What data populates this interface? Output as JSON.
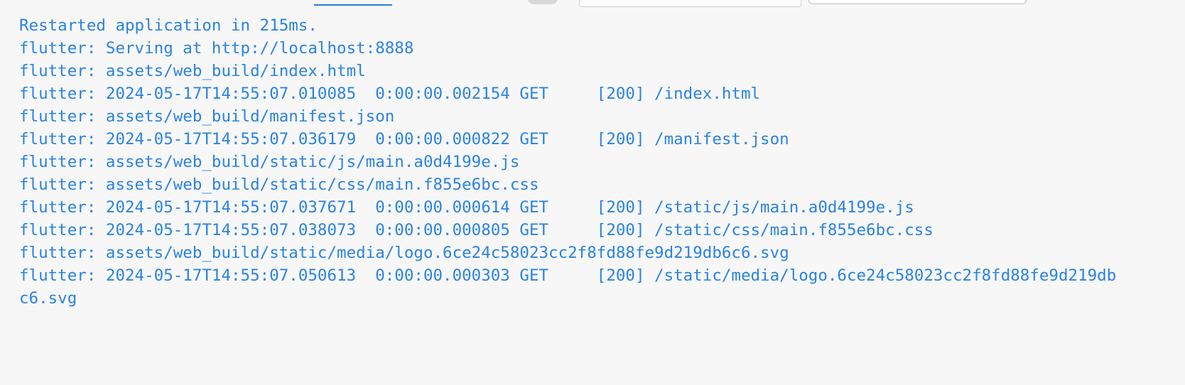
{
  "toolbar": {
    "filter_placeholder": "",
    "level_value": ""
  },
  "console": {
    "lines": [
      "Restarted application in 215ms.",
      "flutter: Serving at http://localhost:8888",
      "flutter: assets/web_build/index.html",
      "flutter: 2024-05-17T14:55:07.010085  0:00:00.002154 GET     [200] /index.html",
      "flutter: assets/web_build/manifest.json",
      "flutter: 2024-05-17T14:55:07.036179  0:00:00.000822 GET     [200] /manifest.json",
      "flutter: assets/web_build/static/js/main.a0d4199e.js",
      "flutter: assets/web_build/static/css/main.f855e6bc.css",
      "flutter: 2024-05-17T14:55:07.037671  0:00:00.000614 GET     [200] /static/js/main.a0d4199e.js",
      "flutter: 2024-05-17T14:55:07.038073  0:00:00.000805 GET     [200] /static/css/main.f855e6bc.css",
      "flutter: assets/web_build/static/media/logo.6ce24c58023cc2f8fd88fe9d219db6c6.svg",
      "flutter: 2024-05-17T14:55:07.050613  0:00:00.000303 GET     [200] /static/media/logo.6ce24c58023cc2f8fd88fe9d219db",
      "c6.svg"
    ]
  },
  "colors": {
    "log_text": "#2b83e0",
    "background": "#f7f7f7",
    "accent": "#2a7fd4"
  }
}
